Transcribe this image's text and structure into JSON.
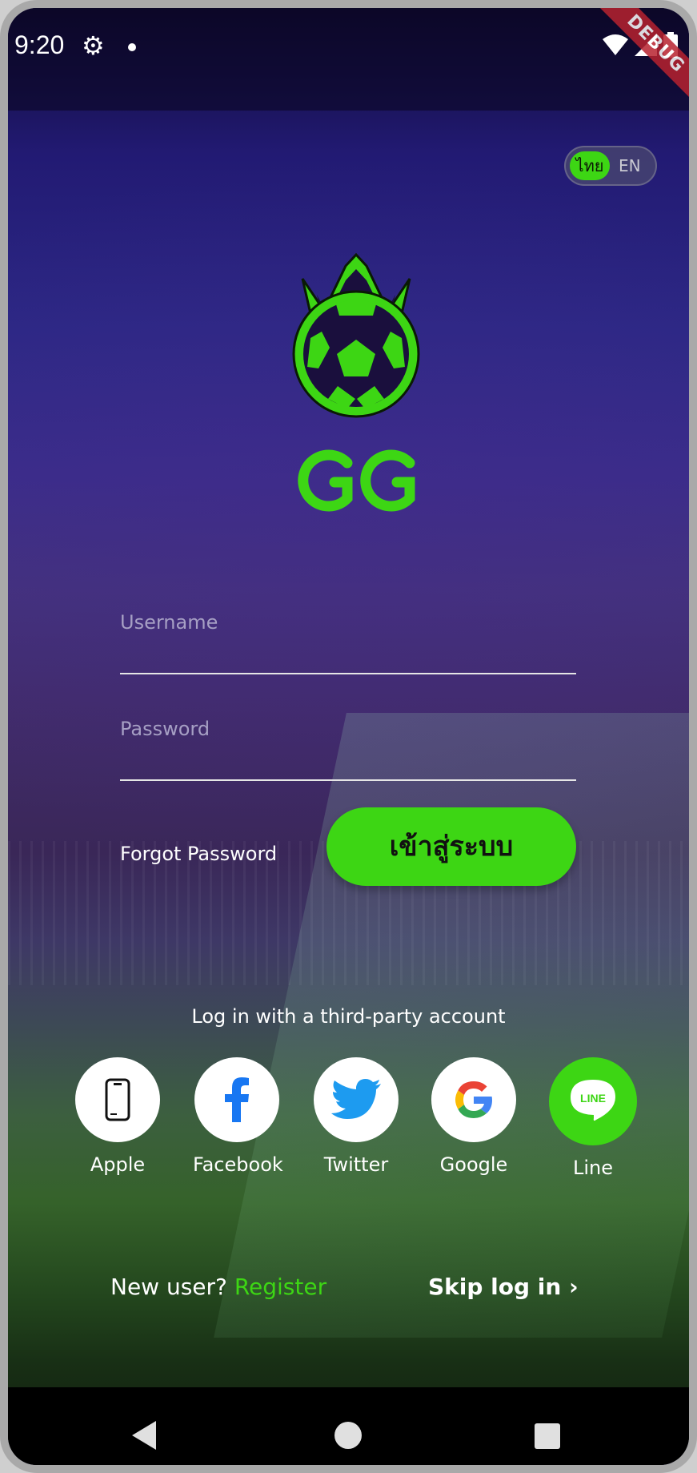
{
  "status_bar": {
    "time": "9:20",
    "debug_banner": "DEBUG"
  },
  "language": {
    "thai": "ไทย",
    "english": "EN",
    "selected": "thai"
  },
  "form": {
    "username_placeholder": "Username",
    "password_placeholder": "Password",
    "forgot_password": "Forgot Password",
    "login_button": "เข้าสู่ระบบ"
  },
  "third_party": {
    "title": "Log in with a third-party account",
    "providers": [
      {
        "label": "Apple",
        "icon": "phone-icon"
      },
      {
        "label": "Facebook",
        "icon": "facebook-icon"
      },
      {
        "label": "Twitter",
        "icon": "twitter-icon"
      },
      {
        "label": "Google",
        "icon": "google-icon"
      },
      {
        "label": "Line",
        "icon": "line-icon",
        "logo_text": "LINE"
      }
    ]
  },
  "footer": {
    "new_user": "New user?",
    "register": "Register",
    "skip_login": "Skip log in"
  },
  "colors": {
    "accent": "#3dd614",
    "background_top": "#221a73",
    "field_label": "#a69fc4"
  }
}
